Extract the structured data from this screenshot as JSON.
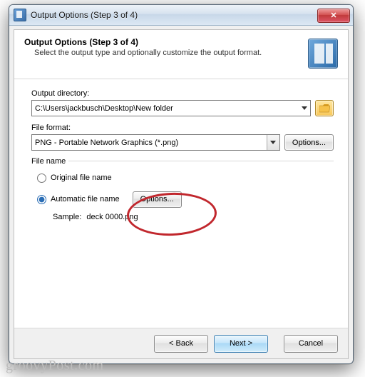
{
  "window": {
    "title": "Output Options (Step 3 of 4)",
    "close_icon": "✕"
  },
  "header": {
    "title": "Output Options (Step 3 of 4)",
    "subtitle": "Select the output type and optionally customize the output format."
  },
  "output_dir": {
    "label": "Output directory:",
    "value": "C:\\Users\\jackbusch\\Desktop\\New folder"
  },
  "file_format": {
    "label": "File format:",
    "value": "PNG - Portable Network Graphics (*.png)",
    "options_btn": "Options..."
  },
  "file_name": {
    "group_label": "File name",
    "original_label": "Original file name",
    "automatic_label": "Automatic file name",
    "selected": "automatic",
    "options_btn": "Options...",
    "sample_label": "Sample:",
    "sample_value": "deck 0000.png"
  },
  "footer": {
    "back": "< Back",
    "next": "Next >",
    "cancel": "Cancel"
  },
  "watermark": "groovyPost.com"
}
